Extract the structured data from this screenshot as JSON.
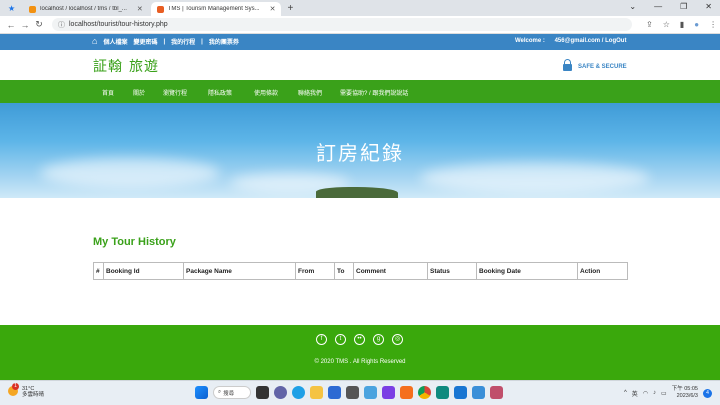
{
  "browser": {
    "tabs": [
      {
        "title": "localhost / localhost / tms / tbl_...",
        "fav_color": "#f29111"
      },
      {
        "title": "TMS | Tourism Management Sys...",
        "fav_color": "#e85d22"
      }
    ],
    "new_tab": "+",
    "url": "localhost/tourist/tour-history.php"
  },
  "topbar": {
    "links": [
      "個人檔案",
      "變更密碼",
      "我的行程",
      "我的團票券"
    ],
    "welcome": "Welcome :",
    "email": "456@gmail.com",
    "logout": "LogOut"
  },
  "header": {
    "logo_a": "証翰",
    "logo_b": "旅遊",
    "secure": "SAFE & SECURE"
  },
  "nav": {
    "items": [
      "首頁",
      "關於",
      "瀏覽行程",
      "隱私政策",
      "使用條款",
      "聯絡我們",
      "需要協助? / 跟我們說說話"
    ]
  },
  "banner": {
    "title": "訂房紀錄"
  },
  "main": {
    "title": "My Tour History",
    "columns": [
      "#",
      "Booking Id",
      "Package Name",
      "From",
      "To",
      "Comment",
      "Status",
      "Booking Date",
      "Action"
    ]
  },
  "footer": {
    "social": [
      "facebook-icon",
      "twitter-icon",
      "flickr-icon",
      "google-plus-icon",
      "dribbble-icon"
    ],
    "copyright": "© 2020 TMS . All Rights Reserved"
  },
  "taskbar": {
    "temp": "31°C",
    "weather": "多雲時晴",
    "search": "搜尋",
    "ime": "英",
    "time": "下午 05:05",
    "date": "2023/6/3",
    "notifications": "4",
    "weather_badge": "1"
  },
  "colors": {
    "accent_green": "#3aa11a",
    "topbar_blue": "#3a85c4",
    "footer_green": "#3aa80c"
  }
}
